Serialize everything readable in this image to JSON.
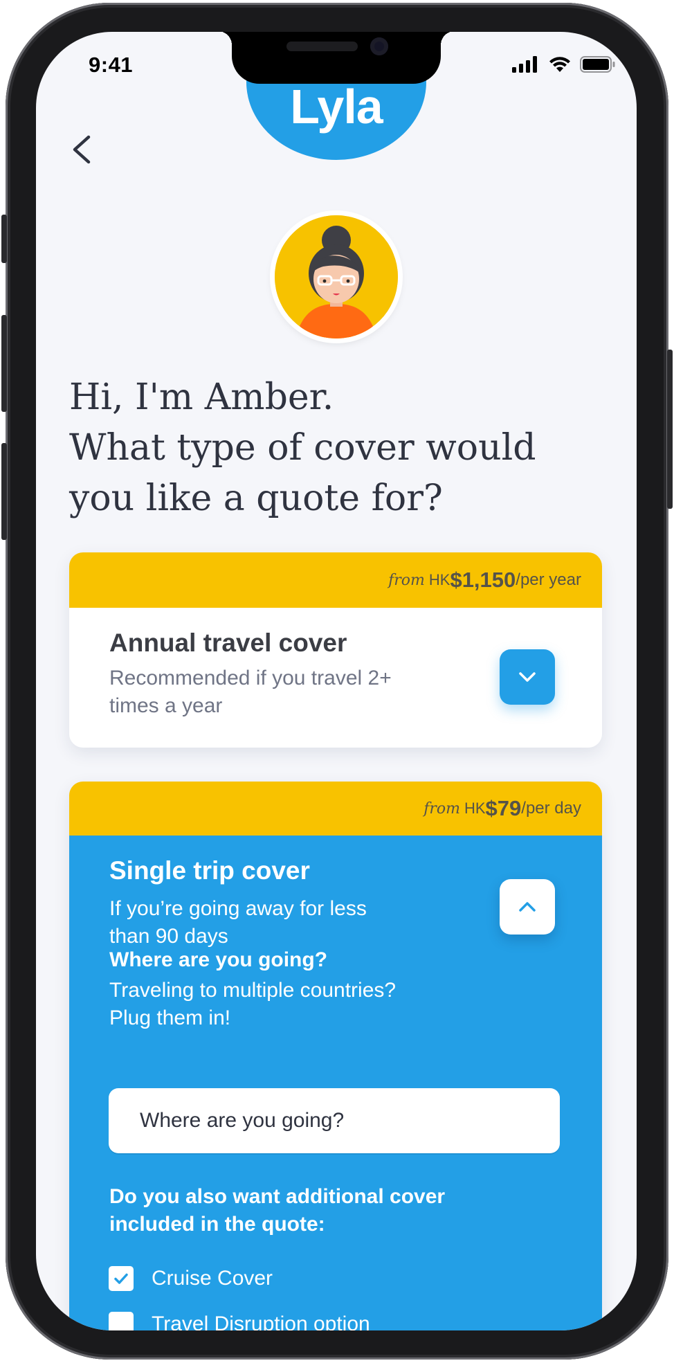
{
  "status_bar": {
    "time": "9:41"
  },
  "brand": {
    "name": "Lyla"
  },
  "greeting": {
    "line1": "Hi, I'm Amber.",
    "line2": "What type of cover would",
    "line3": "you like a quote for?"
  },
  "annual": {
    "price_prefix": "from",
    "currency": "HK",
    "amount": "$1,150",
    "period": "/per year",
    "title": "Annual travel cover",
    "subtitle_line1": "Recommended if you travel 2+",
    "subtitle_line2": "times a year",
    "expanded": false
  },
  "single": {
    "price_prefix": "from",
    "currency": "HK",
    "amount": "$79",
    "period": "/per day",
    "title": "Single trip cover",
    "subtitle_line1": "If you’re going away for less",
    "subtitle_line2": "than 90 days",
    "expanded": true,
    "destination_question": "Where are you going?",
    "destination_hint_line1": "Traveling to multiple countries?",
    "destination_hint_line2": "Plug them in!",
    "destination_placeholder": "Where are you going?",
    "additional_question_line1": "Do you also want additional cover",
    "additional_question_line2": "included in the quote:",
    "options": [
      {
        "label": "Cruise Cover",
        "checked": true
      },
      {
        "label": "Travel Disruption option",
        "checked": false
      }
    ]
  },
  "colors": {
    "brand_blue": "#239fe6",
    "price_yellow": "#f8c200",
    "background": "#f5f6fa",
    "heading_text": "#2f3340"
  },
  "icons": {
    "back": "chevron-left-icon",
    "annual_toggle": "chevron-down-icon",
    "single_toggle": "chevron-up-icon",
    "checkbox": "check-icon"
  }
}
